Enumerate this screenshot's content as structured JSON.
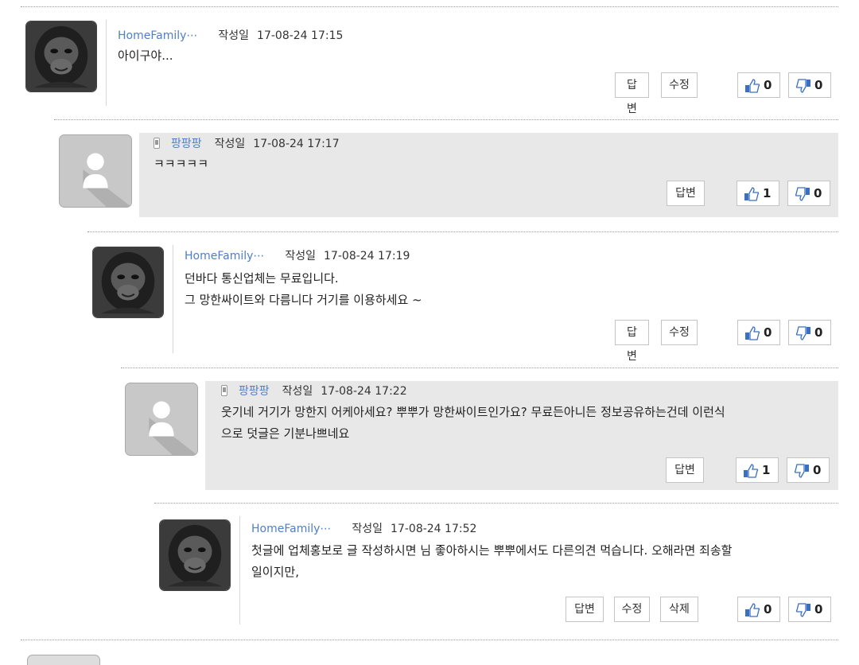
{
  "comments": [
    {
      "author": "HomeFamily⋯",
      "date_label": "작성일",
      "date": "17-08-24 17:15",
      "text": [
        "아이구야..."
      ],
      "reply_label": "답변",
      "edit_label": "수정",
      "likes": "0",
      "dislikes": "0"
    },
    {
      "author": "팡팡팡",
      "date_label": "작성일",
      "date": "17-08-24 17:17",
      "text": [
        "ㅋㅋㅋㅋㅋ"
      ],
      "reply_label": "답변",
      "likes": "1",
      "dislikes": "0"
    },
    {
      "author": "HomeFamily⋯",
      "date_label": "작성일",
      "date": "17-08-24 17:19",
      "text": [
        "던바다 통신업체는 무료입니다.",
        "그 망한싸이트와 다름니다 거기를 이용하세요 ~"
      ],
      "reply_label": "답변",
      "edit_label": "수정",
      "likes": "0",
      "dislikes": "0"
    },
    {
      "author": "팡팡팡",
      "date_label": "작성일",
      "date": "17-08-24 17:22",
      "text": [
        "웃기네 거기가 망한지 어케아세요? 뿌뿌가 망한싸이트인가요? 무료든아니든 정보공유하는건데 이런식",
        "으로 덧글은 기분나쁘네요"
      ],
      "reply_label": "답변",
      "likes": "1",
      "dislikes": "0"
    },
    {
      "author": "HomeFamily⋯",
      "date_label": "작성일",
      "date": "17-08-24 17:52",
      "text": [
        "첫글에 업체홍보로 글 작성하시면 님 좋아하시는 뿌뿌에서도 다른의견 먹습니다. 오해라면 죄송할",
        "일이지만,"
      ],
      "reply_label": "답변",
      "edit_label": "수정",
      "delete_label": "삭제",
      "likes": "0",
      "dislikes": "0"
    }
  ],
  "colors": {
    "nickname": "#4f7fc8",
    "reply_bg": "#e8e8e8",
    "thumb": "#3b6fc1"
  }
}
